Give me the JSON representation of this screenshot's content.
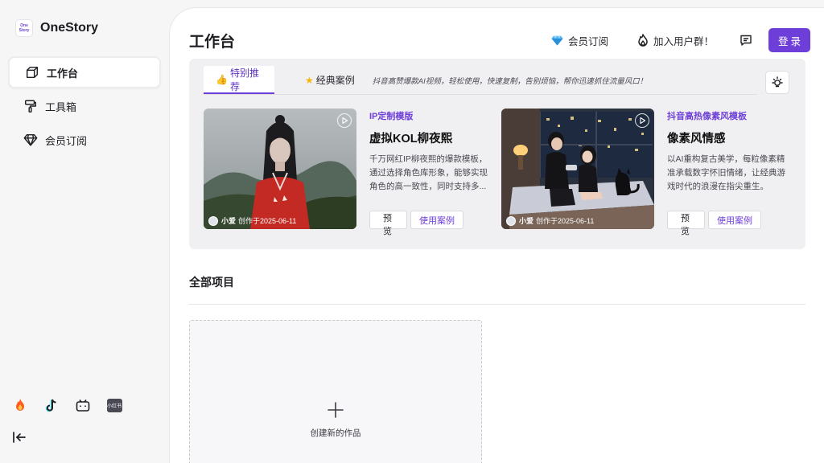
{
  "brand": {
    "logo_line1": "One",
    "logo_line2": "Story",
    "name": "OneStory"
  },
  "sidebar": {
    "items": [
      {
        "label": "工作台",
        "icon": "cube-icon",
        "active": true
      },
      {
        "label": "工具箱",
        "icon": "paint-roller-icon",
        "active": false
      },
      {
        "label": "会员订阅",
        "icon": "diamond-icon",
        "active": false
      }
    ],
    "social": [
      "fire-icon",
      "tiktok-icon",
      "bilibili-icon",
      "xiaohongshu-icon"
    ],
    "xhs_text": "小红书"
  },
  "header": {
    "title": "工作台",
    "subscribe": "会员订阅",
    "join_group": "加入用户群！",
    "login": "登录"
  },
  "featured": {
    "tabs": [
      {
        "label": "特别推荐",
        "icon": "thumbs-up-icon",
        "active": true
      },
      {
        "label": "经典案例",
        "icon": "star-icon",
        "active": false
      }
    ],
    "tip": "抖音高赞爆款AI视频，轻松使用，快速复制，告别烦恼，帮你迅速抓住流量风口！",
    "cards": [
      {
        "tag": "IP定制模版",
        "title": "虚拟KOL柳夜熙",
        "desc": "千万网红IP柳夜熙的爆款模板，通过选择角色库形象，能够实现角色的高一致性，同时支持多...",
        "author": "小爱",
        "created": "创作于2025-06-11",
        "preview": "预览",
        "use_case": "使用案例"
      },
      {
        "tag": "抖音高热像素风模板",
        "title": "像素风情感",
        "desc": "以AI重构复古美学，每粒像素精准承载数字怀旧情绪，让经典游戏时代的浪漫在指尖重生。",
        "author": "小爱",
        "created": "创作于2025-06-11",
        "preview": "预览",
        "use_case": "使用案例"
      }
    ]
  },
  "projects": {
    "title": "全部项目",
    "create_label": "创建新的作品"
  },
  "colors": {
    "accent": "#6e3fd8",
    "panel": "#f0f0f3"
  }
}
